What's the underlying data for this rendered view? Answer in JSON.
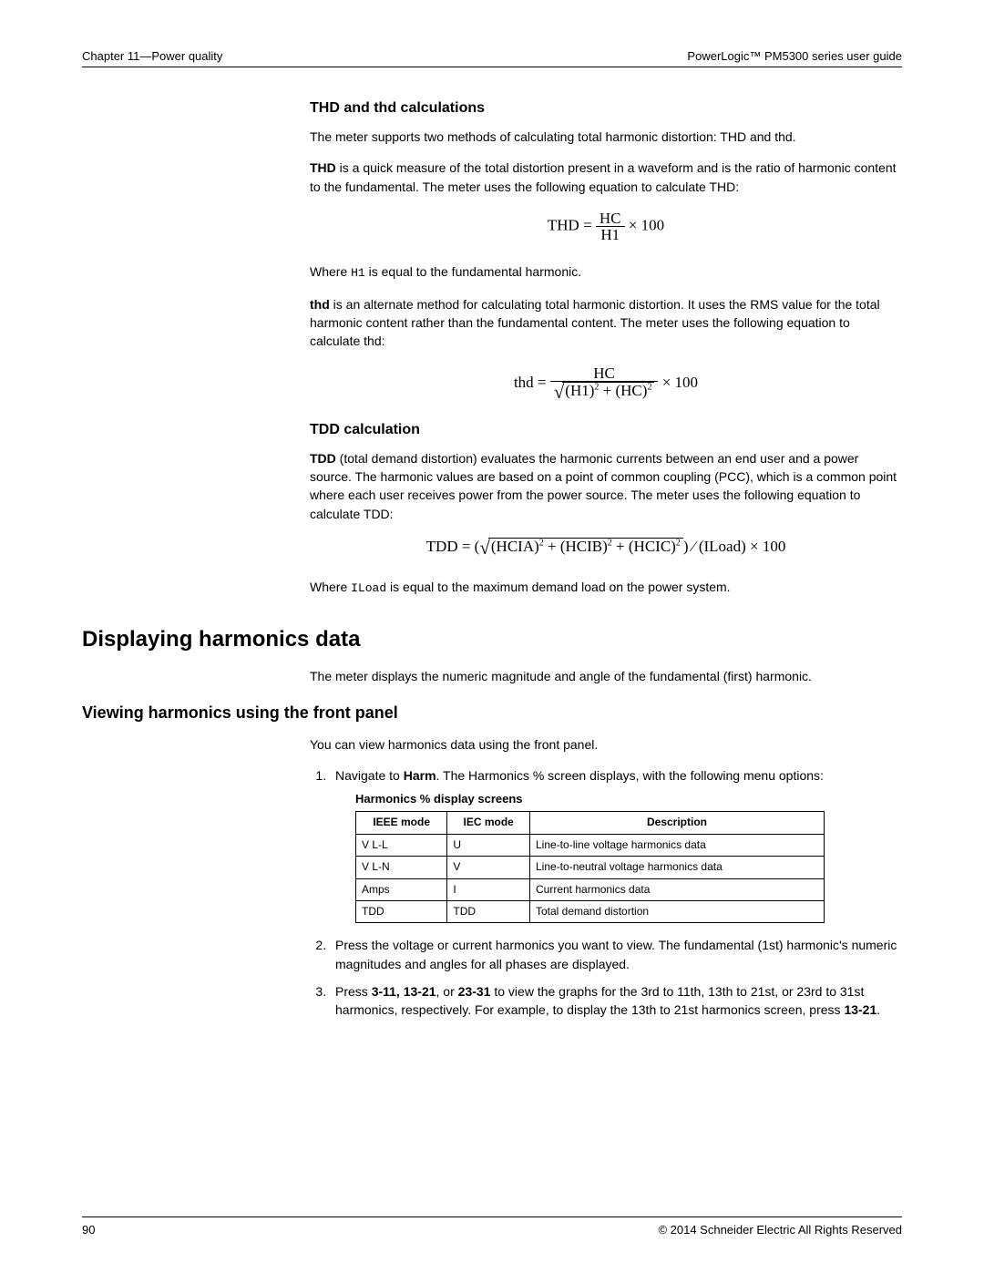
{
  "header": {
    "left": "Chapter 11—Power quality",
    "right": "PowerLogic™ PM5300 series user guide"
  },
  "section1": {
    "title": "THD and thd calculations",
    "p1": "The meter supports two methods of calculating total harmonic distortion: THD and thd.",
    "p2_bold": "THD",
    "p2_rest": " is a quick measure of the total distortion present in a waveform and is the ratio of harmonic content to the fundamental. The meter uses the following equation to calculate THD:",
    "p3_a": "Where ",
    "p3_code": "H1",
    "p3_b": " is equal to the fundamental harmonic.",
    "p4_bold": "thd",
    "p4_rest": " is an alternate method for calculating total harmonic distortion. It uses the RMS value for the total harmonic content rather than the fundamental content. The meter uses the following equation to calculate thd:"
  },
  "section2": {
    "title": "TDD calculation",
    "p1_bold": "TDD",
    "p1_rest": " (total demand distortion) evaluates the harmonic currents between an end user and a power source. The harmonic values are based on a point of common coupling (PCC), which is a common point where each user receives power from the power source. The meter uses the following equation to calculate TDD:",
    "p2_a": "Where ",
    "p2_code": "ILoad",
    "p2_b": " is equal to the maximum demand load on the power system."
  },
  "section3": {
    "title": "Displaying harmonics data",
    "p1": "The meter displays the numeric magnitude and angle of the fundamental (first) harmonic."
  },
  "section4": {
    "title": "Viewing harmonics using the front panel",
    "p1": "You can view harmonics data using the front panel.",
    "step1_a": "Navigate to ",
    "step1_bold": "Harm",
    "step1_b": ". The Harmonics % screen displays, with the following menu options:",
    "table_caption": "Harmonics % display screens",
    "table": {
      "headers": {
        "c1": "IEEE mode",
        "c2": "IEC mode",
        "c3": "Description"
      },
      "rows": [
        {
          "c1": "V L-L",
          "c2": "U",
          "c3": "Line-to-line voltage harmonics data"
        },
        {
          "c1": "V L-N",
          "c2": "V",
          "c3": "Line-to-neutral voltage harmonics data"
        },
        {
          "c1": "Amps",
          "c2": "I",
          "c3": "Current harmonics data"
        },
        {
          "c1": "TDD",
          "c2": "TDD",
          "c3": "Total demand distortion"
        }
      ]
    },
    "step2": "Press the voltage or current harmonics you want to view. The fundamental (1st) harmonic's numeric magnitudes and angles for all phases are displayed.",
    "step3_a": "Press ",
    "step3_bold": "3-11, 13-21",
    "step3_b": ", or ",
    "step3_bold2": "23-31",
    "step3_c": " to view the graphs for the 3rd to 11th, 13th to 21st, or 23rd to 31st harmonics, respectively. For example, to display the 13th to 21st harmonics screen, press ",
    "step3_bold3": "13-21",
    "step3_d": "."
  },
  "footer": {
    "page": "90",
    "copyright": "© 2014 Schneider Electric All Rights Reserved"
  }
}
